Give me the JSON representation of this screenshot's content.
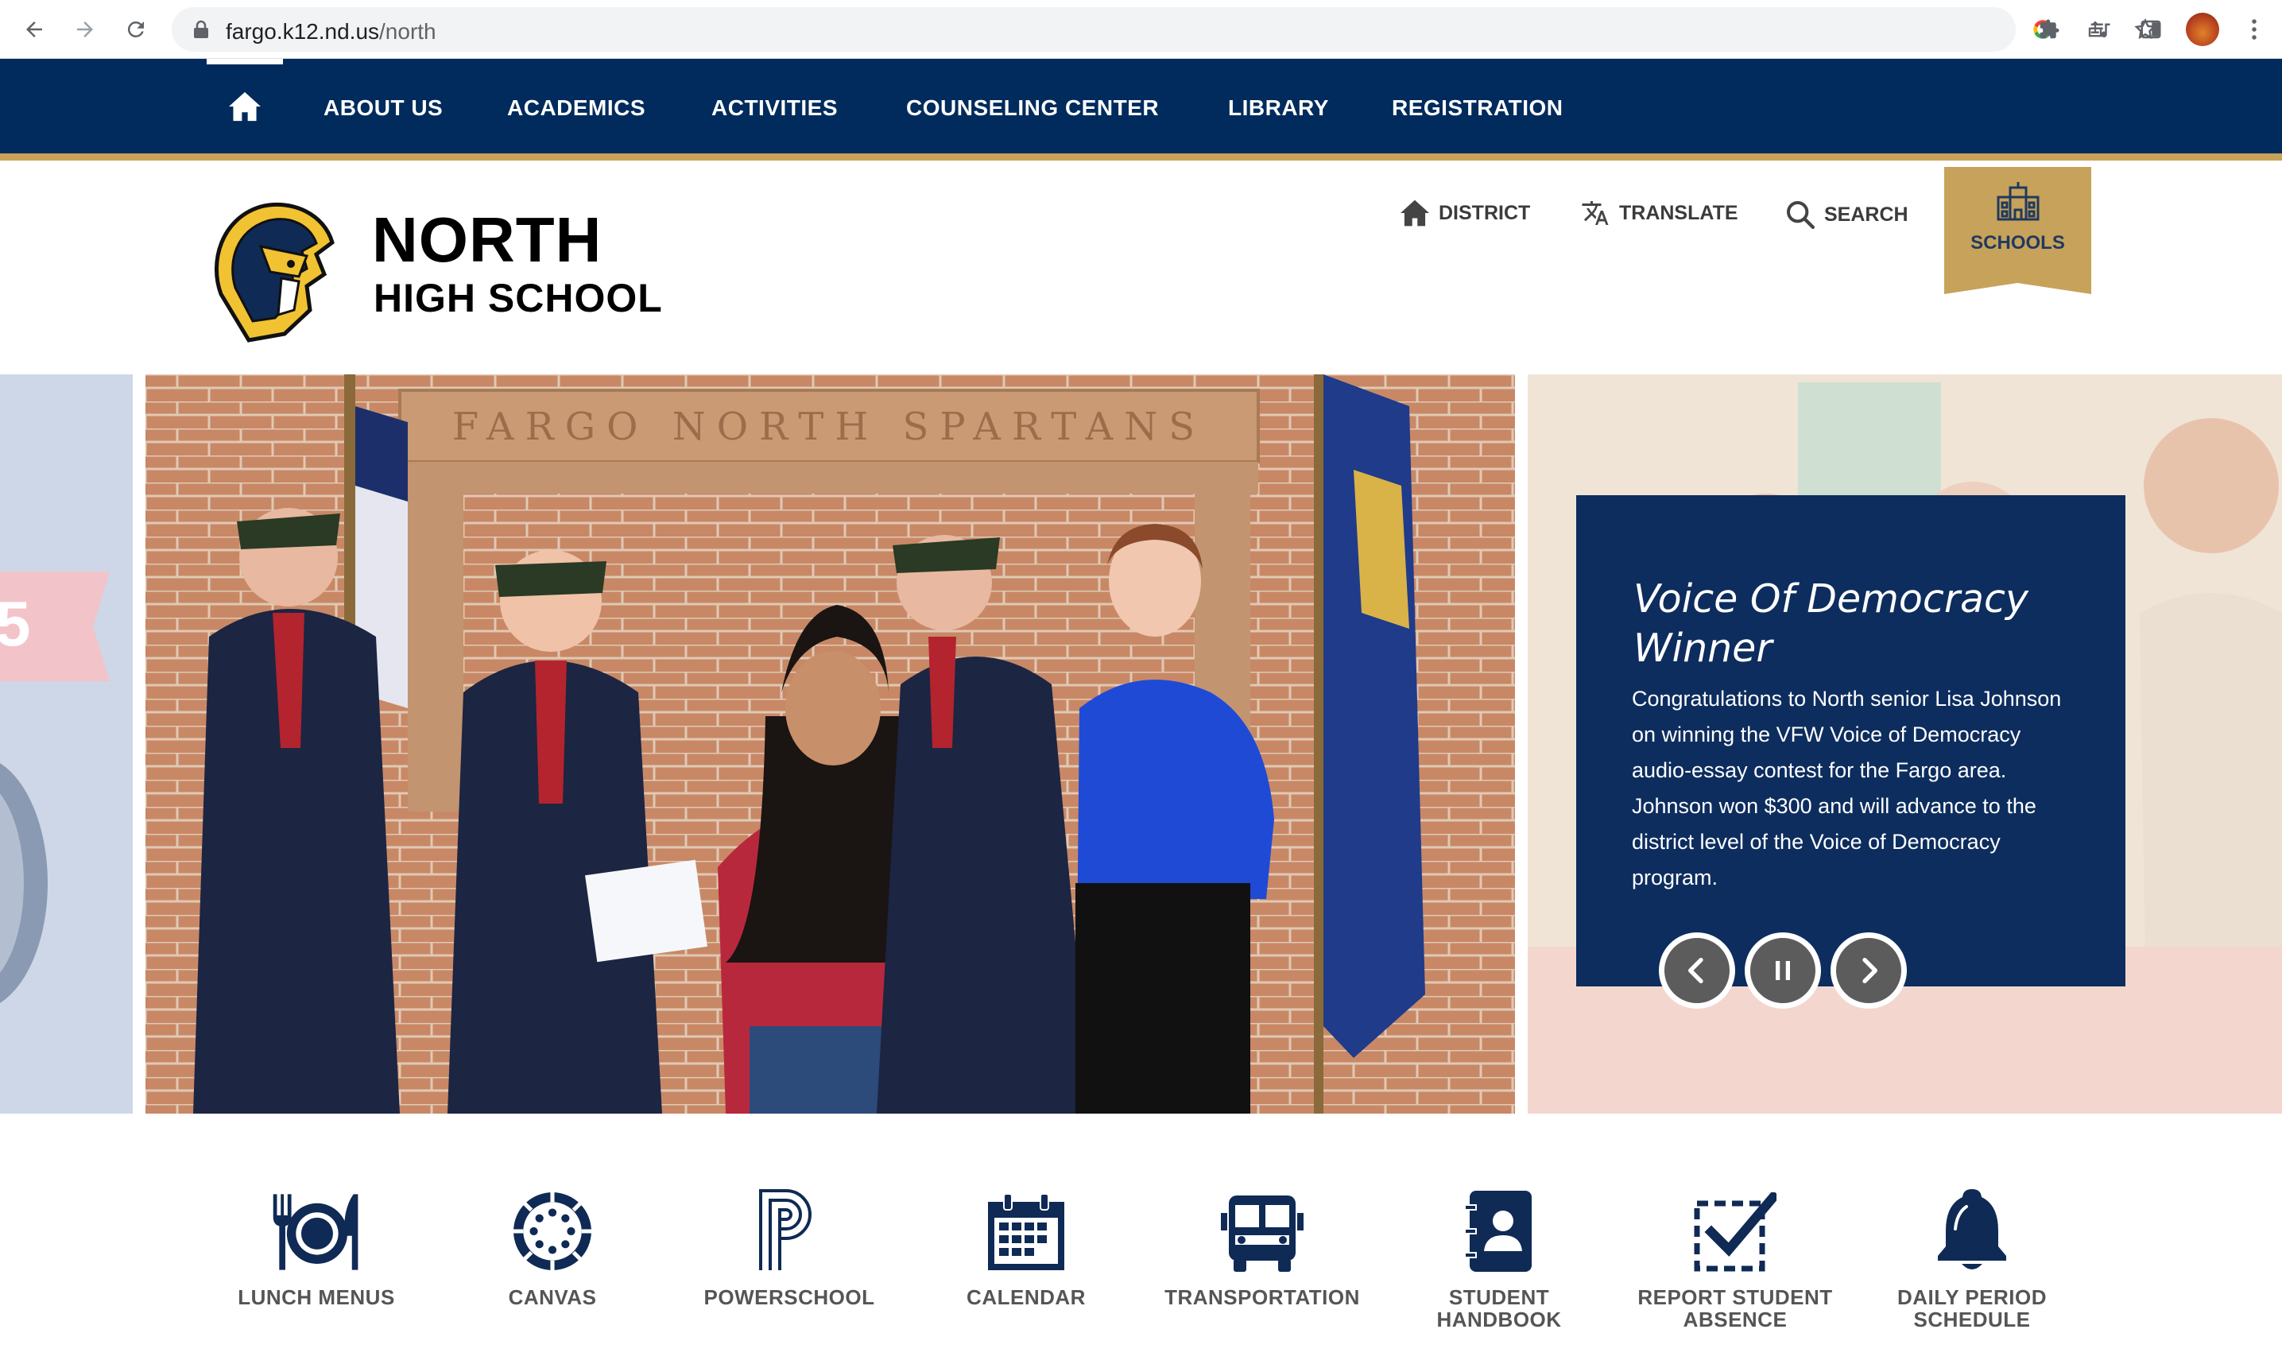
{
  "browser": {
    "url_host": "fargo.k12.nd.us",
    "url_path": "/north"
  },
  "nav": {
    "items": [
      "ABOUT US",
      "ACADEMICS",
      "ACTIVITIES",
      "COUNSELING CENTER",
      "LIBRARY",
      "REGISTRATION"
    ]
  },
  "header": {
    "title_line1": "NORTH",
    "title_line2": "HIGH SCHOOL",
    "district": "DISTRICT",
    "translate": "TRANSLATE",
    "search": "SEARCH",
    "schools": "SCHOOLS"
  },
  "hero": {
    "wall_lettering": "FARGO NORTH SPARTANS",
    "slide_left_number": "5",
    "caption_title": "Voice Of Democracy Winner",
    "caption_body": "Congratulations to North senior Lisa Johnson on winning the VFW Voice of Democracy audio-essay contest for the Fargo area. Johnson won $300 and will advance to the district level of the Voice of Democracy program."
  },
  "quick_links": [
    {
      "label": "LUNCH MENUS",
      "icon": "utensils-icon"
    },
    {
      "label": "CANVAS",
      "icon": "canvas-icon"
    },
    {
      "label": "POWERSCHOOL",
      "icon": "powerschool-icon"
    },
    {
      "label": "CALENDAR",
      "icon": "calendar-icon"
    },
    {
      "label": "TRANSPORTATION",
      "icon": "bus-icon"
    },
    {
      "label": "STUDENT HANDBOOK",
      "icon": "handbook-icon"
    },
    {
      "label": "REPORT STUDENT ABSENCE",
      "icon": "check-box-icon"
    },
    {
      "label": "DAILY PERIOD SCHEDULE",
      "icon": "bell-icon"
    }
  ],
  "colors": {
    "navy": "#002b5c",
    "gold": "#c7a25a",
    "caption_bg": "#0d2d5e",
    "icon": "#0f2a55"
  }
}
